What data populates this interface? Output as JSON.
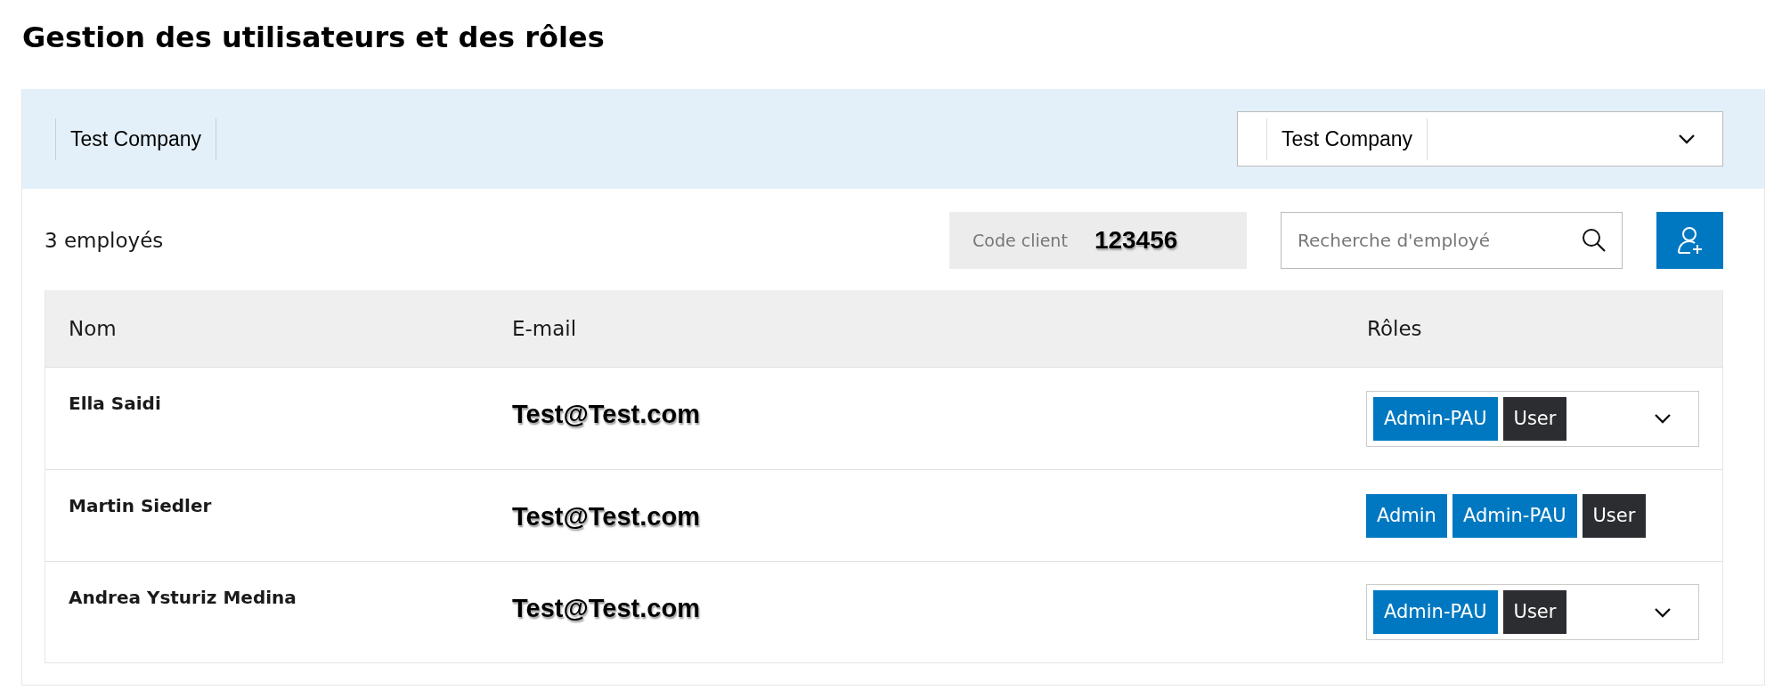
{
  "page_title": "Gestion des utilisateurs et des rôles",
  "company_header": {
    "label": "Test Company",
    "select": {
      "value": "Test Company"
    }
  },
  "toolbar": {
    "count": "3 employés",
    "client_code": {
      "label": "Code client",
      "value": "123456"
    },
    "search": {
      "placeholder": "Recherche d'employé"
    }
  },
  "table": {
    "columns": [
      "Nom",
      "E-mail",
      "Rôles"
    ],
    "rows": [
      {
        "name": "Ella Saidi",
        "email": "Test@Test.com",
        "kind": "dropdown",
        "roles": [
          {
            "label": "Admin-PAU",
            "color": "#0078c1"
          },
          {
            "label": "User",
            "color": "#2b2d31"
          }
        ]
      },
      {
        "name": "Martin Siedler",
        "email": "Test@Test.com",
        "kind": "plain",
        "roles": [
          {
            "label": "Admin",
            "color": "#0078c1"
          },
          {
            "label": "Admin-PAU",
            "color": "#0078c1"
          },
          {
            "label": "User",
            "color": "#2b2d31"
          }
        ]
      },
      {
        "name": "Andrea Ysturiz Medina",
        "email": "Test@Test.com",
        "kind": "dropdown",
        "roles": [
          {
            "label": "Admin-PAU",
            "color": "#0078c1"
          },
          {
            "label": "User",
            "color": "#2b2d31"
          }
        ]
      }
    ]
  }
}
